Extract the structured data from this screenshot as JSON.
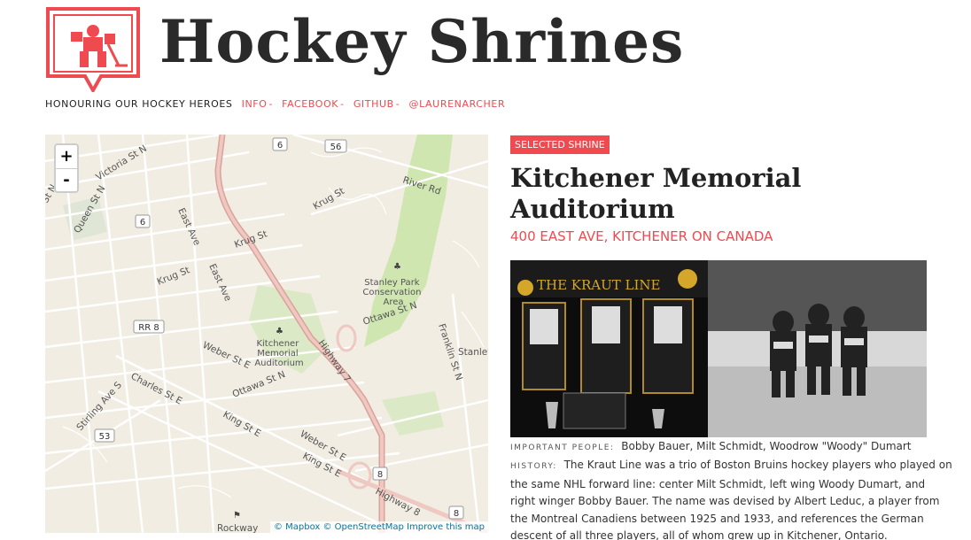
{
  "header": {
    "site_title": "Hockey Shrines",
    "tagline": "HONOURING OUR HOCKEY HEROES",
    "links": [
      {
        "label": "INFO"
      },
      {
        "label": "FACEBOOK"
      },
      {
        "label": "GITHUB"
      },
      {
        "label": "@LAURENARCHER"
      }
    ],
    "separator": "-"
  },
  "map": {
    "zoom_in": "+",
    "zoom_out": "-",
    "attribution": "© Mapbox © OpenStreetMap Improve this map",
    "labels": {
      "victoria": "Victoria St N",
      "queen": "Queen St N",
      "krug1": "Krug St",
      "krug2": "Krug St",
      "krug3": "Krug St",
      "east_ave1": "East Ave",
      "east_ave2": "East Ave",
      "river": "River Rd",
      "stanley": "Stanley Park Conservation Area",
      "ottawa1": "Ottawa St N",
      "ottawa2": "Ottawa St N",
      "highway7": "Highway 7",
      "franklin": "Franklin St N",
      "auditorium": "Kitchener Memorial Auditorium",
      "weber1": "Weber St E",
      "weber2": "Weber St E",
      "charles": "Charles St E",
      "king1": "King St E",
      "king2": "King St E",
      "stirling": "Stirling Ave S",
      "highway8": "Highway 8",
      "rockway": "Rockway",
      "stanley_edge": "Stanley",
      "st_n_edge": "St N",
      "rr8": "RR 8",
      "shield_6a": "6",
      "shield_56": "56",
      "shield_6b": "6",
      "shield_53": "53",
      "shield_8a": "8",
      "shield_8b": "8"
    },
    "colors": {
      "land": "#f1ede3",
      "park": "#cfe6b0",
      "road": "#ffffff",
      "highway": "#e7b9b0"
    }
  },
  "shrine": {
    "badge": "SELECTED SHRINE",
    "name": "Kitchener Memorial Auditorium",
    "address": "400 EAST AVE, KITCHENER ON CANADA",
    "photo_sign": "THE KRAUT LINE",
    "people_label": "IMPORTANT PEOPLE:",
    "people": "Bobby Bauer, Milt Schmidt, Woodrow \"Woody\" Dumart",
    "history_label": "HISTORY:",
    "history": "The Kraut Line was a trio of Boston Bruins hockey players who played on the same NHL forward line: center Milt Schmidt, left wing Woody Dumart, and right winger Bobby Bauer. The name was devised by Albert Leduc, a player from the Montreal Canadiens between 1925 and 1933, and references the German descent of all three players, all of whom grew up in Kitchener, Ontario."
  },
  "theme": {
    "accent": "#ef4a50"
  }
}
